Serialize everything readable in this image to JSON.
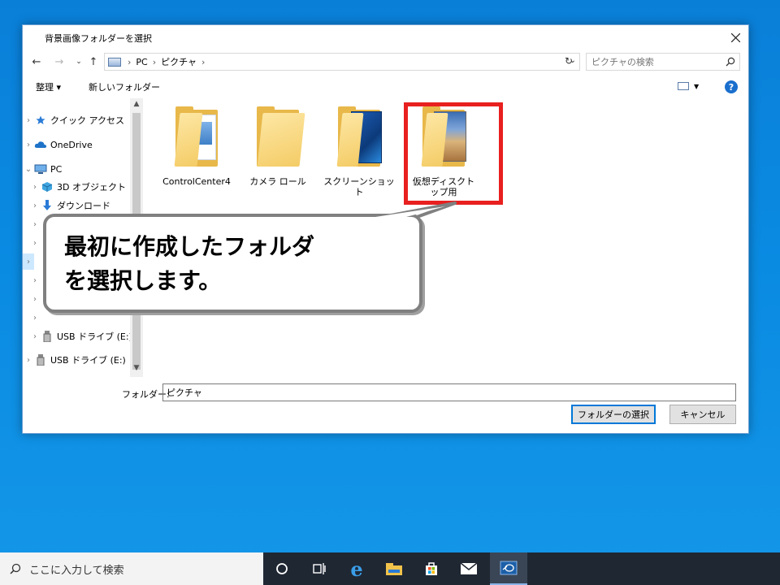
{
  "dialog": {
    "title": "背景画像フォルダーを選択",
    "breadcrumb": [
      "PC",
      "ピクチャ"
    ],
    "search_placeholder": "ピクチャの検索",
    "toolbar": {
      "organize": "整理 ▾",
      "new_folder": "新しいフォルダー"
    },
    "help": "?",
    "tree": [
      {
        "label": "クイック アクセス",
        "icon": "star-icon",
        "level": 0
      },
      {
        "label": "OneDrive",
        "icon": "cloud-icon",
        "level": 0
      },
      {
        "label": "PC",
        "icon": "computer-icon",
        "level": 0,
        "expanded": true
      },
      {
        "label": "3D オブジェクト",
        "icon": "cube-icon",
        "level": 1
      },
      {
        "label": "ダウンロード",
        "icon": "download-icon",
        "level": 1
      },
      {
        "label": "USB ドライブ (E:)",
        "icon": "usb-icon",
        "level": 1
      },
      {
        "label": "USB ドライブ (E:)",
        "icon": "usb-icon",
        "level": 0
      }
    ],
    "folders": [
      {
        "label": "ControlCenter4",
        "thumb": "document"
      },
      {
        "label": "カメラ ロール",
        "thumb": "plain"
      },
      {
        "label": "スクリーンショット",
        "thumb": "windows"
      },
      {
        "label": "仮想ディスクトップ用",
        "thumb": "image",
        "highlighted": true
      }
    ],
    "folder_field_label": "フォルダー:",
    "folder_field_value": "ピクチャ",
    "select_button": "フォルダーの選択",
    "cancel_button": "キャンセル"
  },
  "callout": {
    "text": "最初に作成したフォルダ\nを選択します。"
  },
  "taskbar": {
    "search_placeholder": "ここに入力して検索",
    "icons": [
      "cortana-icon",
      "task-view-icon",
      "edge-icon",
      "explorer-icon",
      "store-icon",
      "mail-icon",
      "app-icon"
    ]
  },
  "colors": {
    "highlight": "#e8201f",
    "desktop": "#0a8be2",
    "taskbar": "#1f2733"
  }
}
